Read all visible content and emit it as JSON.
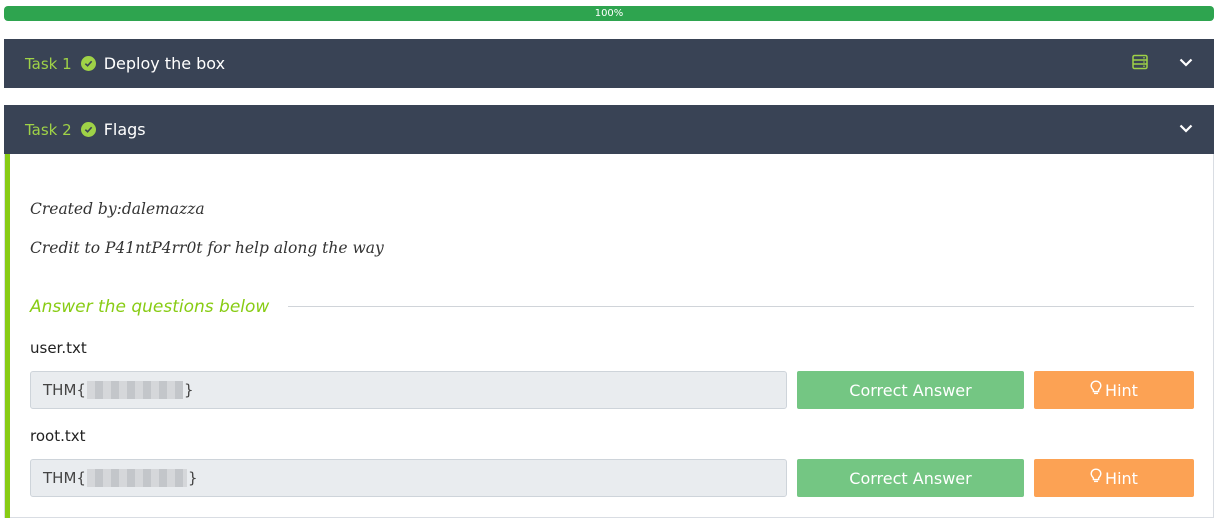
{
  "progress": {
    "percent": 100,
    "label": "100%"
  },
  "tasks": [
    {
      "number_label": "Task 1",
      "title": "Deploy the box"
    },
    {
      "number_label": "Task 2",
      "title": "Flags"
    }
  ],
  "task2": {
    "created_by": "Created by:dalemazza",
    "credit": "Credit to P41ntP4rr0t for help along the way",
    "answer_heading": "Answer the questions below",
    "questions": [
      {
        "label": "user.txt",
        "answer_prefix": "THM{",
        "answer_suffix": "}",
        "correct_label": "Correct Answer",
        "hint_label": "Hint"
      },
      {
        "label": "root.txt",
        "answer_prefix": "THM{",
        "answer_suffix": "}",
        "correct_label": "Correct Answer",
        "hint_label": "Hint"
      }
    ]
  },
  "colors": {
    "header_bg": "#394355",
    "accent_green": "#88cc14",
    "correct_btn": "#74c683",
    "hint_btn": "#fca254",
    "progress_fill": "#2ea44f"
  },
  "icons": [
    "check-circle-icon",
    "server-icon",
    "chevron-down-icon",
    "lightbulb-icon"
  ]
}
